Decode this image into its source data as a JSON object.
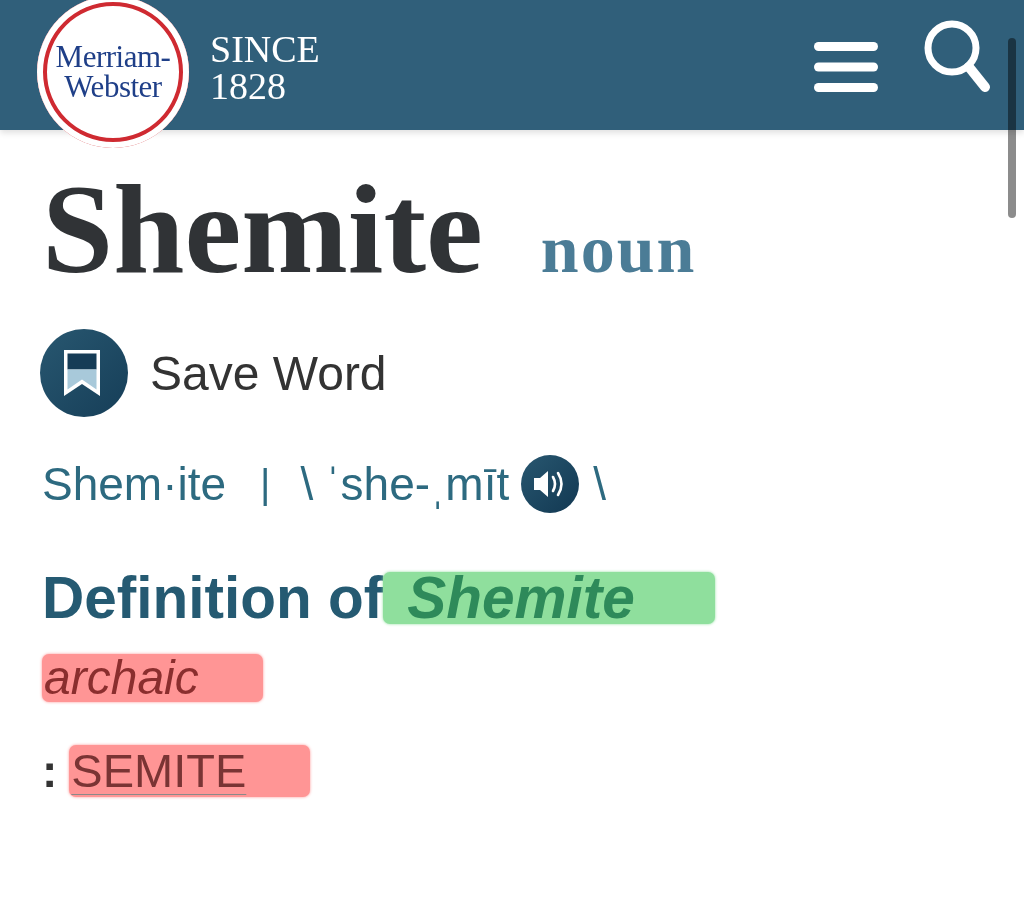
{
  "header": {
    "logo": {
      "lines": [
        "Merriam-",
        "Webster"
      ]
    },
    "tagline": [
      "SINCE",
      "1828"
    ]
  },
  "entry": {
    "headword": "Shemite",
    "part_of_speech": "noun",
    "save_button": {
      "label": "Save Word"
    },
    "pronunciation": {
      "syllables": "Shem·ite",
      "separator": "|",
      "open": "\\",
      "respelling": "ˈshe-ˌmīt",
      "close": "\\"
    }
  },
  "definition": {
    "heading": "Definition of",
    "headword": {
      "text": "Shemite",
      "color": "#8fdf9d"
    },
    "label": {
      "text": "archaic",
      "color": "#ff9595"
    },
    "sense": {
      "colon": ":",
      "cross_reference": {
        "text": "SEMITE",
        "color": "#ff9595"
      }
    }
  }
}
